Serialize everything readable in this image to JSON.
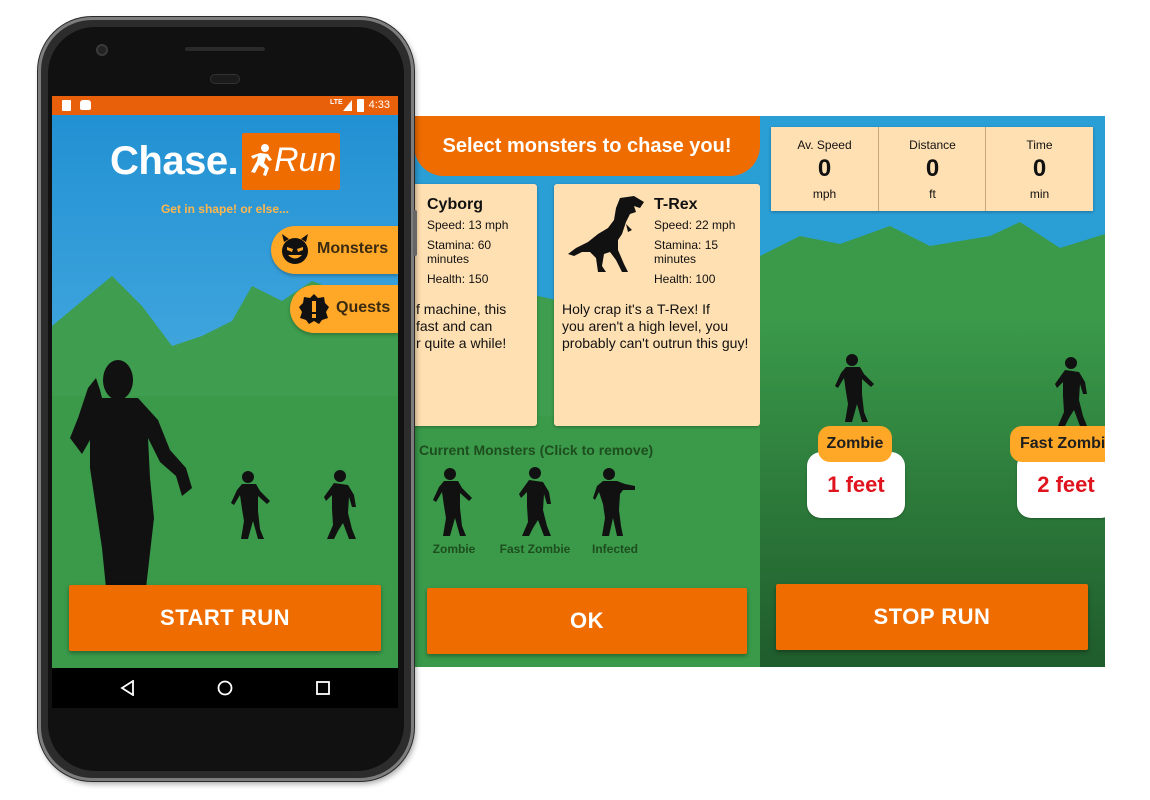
{
  "phone": {
    "status_time": "4:33",
    "status_network": "LTE",
    "app_logo_left": "Chase.",
    "app_logo_right": "Run",
    "tagline": "Get in shape! or else...",
    "menu": [
      {
        "label": "Monsters",
        "icon": "devil-face-icon"
      },
      {
        "label": "Quests",
        "icon": "alert-badge-icon"
      }
    ],
    "start_button": "START RUN",
    "nav": [
      "back-icon",
      "home-icon",
      "recents-icon"
    ]
  },
  "select_screen": {
    "banner": "Select monsters to chase you!",
    "cards": [
      {
        "name": "Cyborg",
        "speed": "Speed: 13 mph",
        "stamina_line1": "Stamina: 60",
        "stamina_line2": "minutes",
        "health": "Health: 150",
        "desc_lines": [
          "f machine, this",
          "fast and can",
          "r quite a while!"
        ]
      },
      {
        "name": "T-Rex",
        "speed": "Speed: 22 mph",
        "stamina_line1": "Stamina: 15",
        "stamina_line2": "minutes",
        "health": "Health: 100",
        "desc_lines": [
          "Holy crap it's a T-Rex! If",
          "you aren't a high level, you",
          "probably can't outrun this guy!"
        ]
      }
    ],
    "current_label": "Current Monsters (Click to remove)",
    "current_monsters": [
      "Zombie",
      "Fast Zombie",
      "Infected"
    ],
    "ok_button": "OK"
  },
  "run_screen": {
    "stats": [
      {
        "label": "Av. Speed",
        "value": "0",
        "unit": "mph"
      },
      {
        "label": "Distance",
        "value": "0",
        "unit": "ft"
      },
      {
        "label": "Time",
        "value": "0",
        "unit": "min"
      }
    ],
    "chasers": [
      {
        "name": "Zombie",
        "distance": "1 feet"
      },
      {
        "name": "Fast Zombi",
        "distance": "2 feet"
      }
    ],
    "stop_button": "STOP RUN"
  },
  "colors": {
    "orange": "#ef6c00",
    "light_orange": "#ffa726",
    "card_bg": "#ffe0b2",
    "sky": "#2a9fd6",
    "grass": "#3a9a4a",
    "distance_text": "#e0141e"
  }
}
